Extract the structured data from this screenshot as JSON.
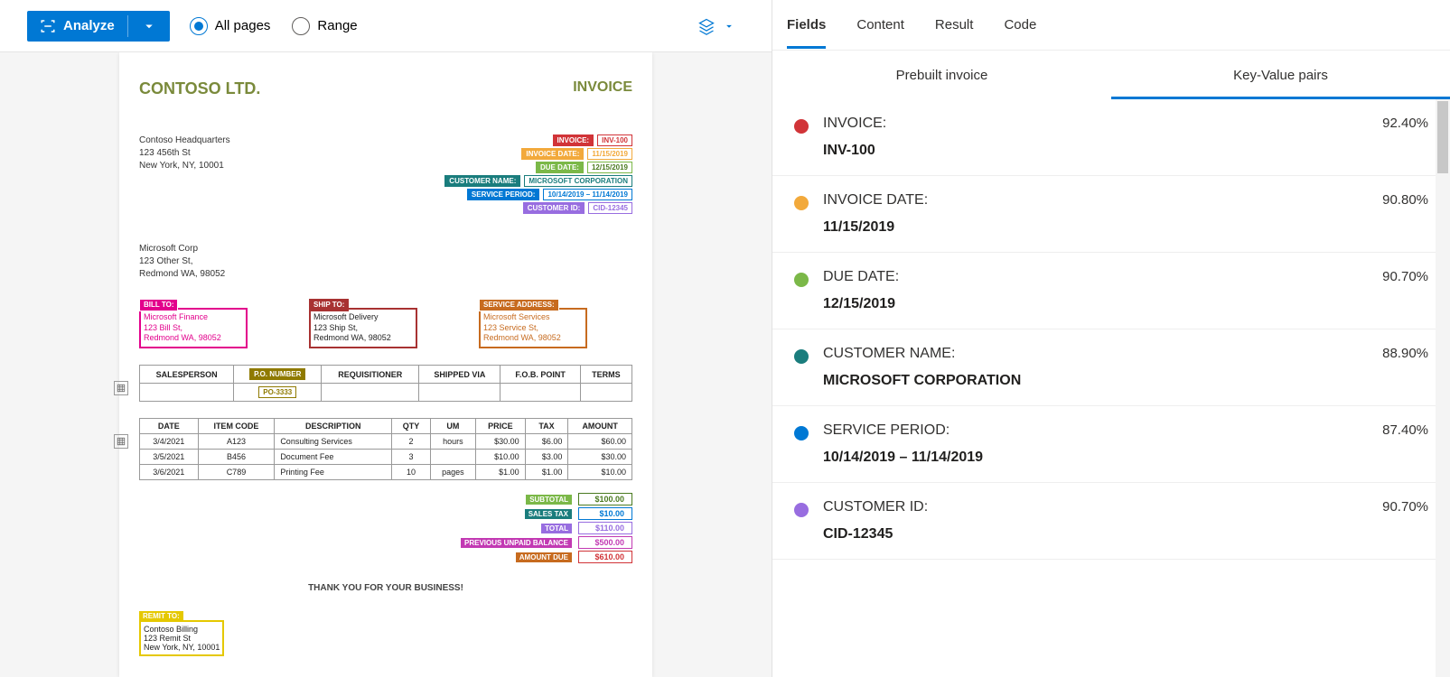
{
  "toolbar": {
    "analyze": "Analyze",
    "all_pages": "All pages",
    "range": "Range"
  },
  "doc": {
    "company": "CONTOSO LTD.",
    "invoice_title": "INVOICE",
    "hq": {
      "l1": "Contoso Headquarters",
      "l2": "123 456th St",
      "l3": "New York, NY, 10001"
    },
    "to": {
      "l1": "Microsoft Corp",
      "l2": "123 Other St,",
      "l3": "Redmond WA, 98052"
    },
    "meta": {
      "invoice_label": "INVOICE:",
      "invoice_val": "INV-100",
      "date_label": "INVOICE DATE:",
      "date_val": "11/15/2019",
      "due_label": "DUE DATE:",
      "due_val": "12/15/2019",
      "cust_label": "CUSTOMER NAME:",
      "cust_val": "MICROSOFT CORPORATION",
      "svc_label": "SERVICE PERIOD:",
      "svc_val": "10/14/2019 – 11/14/2019",
      "cid_label": "CUSTOMER ID:",
      "cid_val": "CID-12345"
    },
    "billto": {
      "title": "BILL TO:",
      "l1": "Microsoft Finance",
      "l2": "123 Bill St,",
      "l3": "Redmond WA, 98052"
    },
    "shipto": {
      "title": "SHIP TO:",
      "l1": "Microsoft Delivery",
      "l2": "123 Ship St,",
      "l3": "Redmond WA, 98052"
    },
    "svcaddr": {
      "title": "SERVICE ADDRESS:",
      "l1": "Microsoft Services",
      "l2": "123 Service St,",
      "l3": "Redmond WA, 98052"
    },
    "po_header": [
      "SALESPERSON",
      "P.O. NUMBER",
      "REQUISITIONER",
      "SHIPPED VIA",
      "F.O.B. POINT",
      "TERMS"
    ],
    "po_val": "PO-3333",
    "items_header": [
      "DATE",
      "ITEM CODE",
      "DESCRIPTION",
      "QTY",
      "UM",
      "PRICE",
      "TAX",
      "AMOUNT"
    ],
    "items": [
      {
        "date": "3/4/2021",
        "code": "A123",
        "desc": "Consulting Services",
        "qty": "2",
        "um": "hours",
        "price": "$30.00",
        "tax": "$6.00",
        "amount": "$60.00"
      },
      {
        "date": "3/5/2021",
        "code": "B456",
        "desc": "Document Fee",
        "qty": "3",
        "um": "",
        "price": "$10.00",
        "tax": "$3.00",
        "amount": "$30.00"
      },
      {
        "date": "3/6/2021",
        "code": "C789",
        "desc": "Printing Fee",
        "qty": "10",
        "um": "pages",
        "price": "$1.00",
        "tax": "$1.00",
        "amount": "$10.00"
      }
    ],
    "totals": {
      "subtotal_label": "SUBTOTAL",
      "subtotal": "$100.00",
      "salestax_label": "SALES TAX",
      "salestax": "$10.00",
      "total_label": "TOTAL",
      "total": "$110.00",
      "prev_label": "PREVIOUS UNPAID BALANCE",
      "prev": "$500.00",
      "due_label": "AMOUNT DUE",
      "due": "$610.00"
    },
    "thankyou": "THANK YOU FOR YOUR BUSINESS!",
    "remit": {
      "title": "REMIT TO:",
      "l1": "Contoso Billing",
      "l2": "123 Remit St",
      "l3": "New York, NY, 10001"
    }
  },
  "tabs": {
    "fields": "Fields",
    "content": "Content",
    "result": "Result",
    "code": "Code"
  },
  "subtabs": {
    "prebuilt": "Prebuilt invoice",
    "kvp": "Key-Value pairs"
  },
  "fields": [
    {
      "color": "#d13438",
      "key": "INVOICE:",
      "val": "INV-100",
      "conf": "92.40%"
    },
    {
      "color": "#f2a93b",
      "key": "INVOICE DATE:",
      "val": "11/15/2019",
      "conf": "90.80%"
    },
    {
      "color": "#7bb848",
      "key": "DUE DATE:",
      "val": "12/15/2019",
      "conf": "90.70%"
    },
    {
      "color": "#1a7d7d",
      "key": "CUSTOMER NAME:",
      "val": "MICROSOFT CORPORATION",
      "conf": "88.90%"
    },
    {
      "color": "#0078d4",
      "key": "SERVICE PERIOD:",
      "val": "10/14/2019 – 11/14/2019",
      "conf": "87.40%"
    },
    {
      "color": "#986de0",
      "key": "CUSTOMER ID:",
      "val": "CID-12345",
      "conf": "90.70%"
    }
  ]
}
